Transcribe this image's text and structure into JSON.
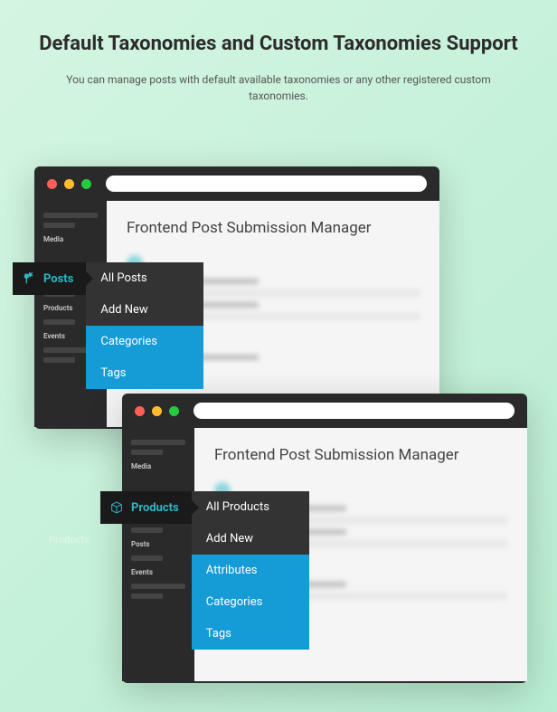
{
  "header": {
    "title": "Default Taxonomies and Custom Taxonomies Support",
    "subtitle": "You can manage posts with default available taxonomies or any other registered custom taxonomies."
  },
  "window1": {
    "content_title": "Frontend Post Submission Manager",
    "sidebar": {
      "labels": [
        "Media",
        "Products",
        "Events"
      ]
    }
  },
  "window2": {
    "content_title": "Frontend Post Submission Manager",
    "sidebar": {
      "labels": [
        "Media",
        "Posts",
        "Events"
      ]
    }
  },
  "flyout1": {
    "tab": "Posts",
    "items": [
      "All Posts",
      "Add New",
      "Categories",
      "Tags"
    ]
  },
  "flyout2": {
    "tab": "Products",
    "items": [
      "All Products",
      "Add New",
      "Attributes",
      "Categories",
      "Tags"
    ]
  },
  "ghost": "Products"
}
